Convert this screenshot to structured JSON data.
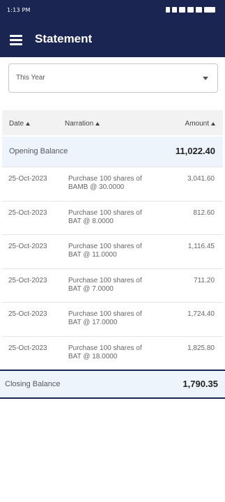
{
  "status_bar": {
    "time": "1:13 PM"
  },
  "app_bar": {
    "title": "Statement"
  },
  "period_select": {
    "value": "This Year"
  },
  "table": {
    "headers": {
      "date": "Date",
      "narration": "Narration",
      "amount": "Amount"
    },
    "opening": {
      "label": "Opening Balance",
      "amount": "11,022.40"
    },
    "rows": [
      {
        "date": "25-Oct-2023",
        "narration": "Purchase 100 shares of BAMB @ 30.0000",
        "amount": "3,041.60"
      },
      {
        "date": "25-Oct-2023",
        "narration": "Purchase 100 shares of BAT @ 8.0000",
        "amount": "812.60"
      },
      {
        "date": "25-Oct-2023",
        "narration": "Purchase 100 shares of BAT @ 11.0000",
        "amount": "1,116.45"
      },
      {
        "date": "25-Oct-2023",
        "narration": "Purchase 100 shares of BAT @ 7.0000",
        "amount": "711.20"
      },
      {
        "date": "25-Oct-2023",
        "narration": "Purchase 100 shares of BAT @ 17.0000",
        "amount": "1,724.40"
      },
      {
        "date": "25-Oct-2023",
        "narration": "Purchase 100 shares of BAT @ 18.0000",
        "amount": "1,825.80"
      }
    ],
    "closing": {
      "label": "Closing Balance",
      "amount": "1,790.35"
    }
  }
}
